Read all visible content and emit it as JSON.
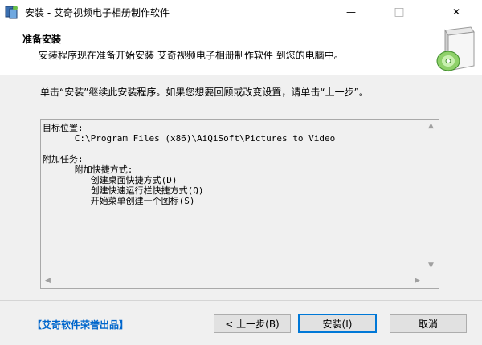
{
  "window": {
    "title": "安装 - 艾奇视频电子相册制作软件",
    "minimize_glyph": "—",
    "maximize_glyph": "□",
    "close_glyph": "✕",
    "icon": "installer-app-icon"
  },
  "header": {
    "title": "准备安装",
    "subtitle": "安装程序现在准备开始安装 艾奇视频电子相册制作软件 到您的电脑中。",
    "art_icon": "software-box-disc-icon"
  },
  "intro_text": "单击“安装”继续此安装程序。如果您想要回顾或改变设置，请单击“上一步”。",
  "memo": {
    "text": "目标位置:\n      C:\\Program Files (x86)\\AiQiSoft\\Pictures to Video\n\n附加任务:\n      附加快捷方式:\n         创建桌面快捷方式(D)\n         创建快速运行栏快捷方式(Q)\n         开始菜单创建一个图标(S)"
  },
  "brand_link": "【艾奇软件荣誉出品】",
  "buttons": {
    "back": "< 上一步(B)",
    "install": "安装(I)",
    "cancel": "取消"
  },
  "colors": {
    "brand": "#0066cc",
    "default_button_border": "#0078d7",
    "disc_green": "#4caf50"
  }
}
